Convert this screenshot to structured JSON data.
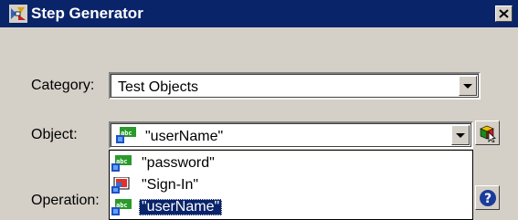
{
  "window": {
    "title": "Step Generator",
    "app_icon": "step-generator-icon",
    "close_icon": "close-icon"
  },
  "category": {
    "label": "Category:",
    "value": "Test Objects"
  },
  "object": {
    "label": "Object:",
    "value": "\"userName\"",
    "value_icon": "webedit-icon",
    "select_object_icon": "select-object-pointer-icon"
  },
  "object_dropdown": {
    "items": [
      {
        "label": "\"password\"",
        "icon": "webedit-icon",
        "selected": false
      },
      {
        "label": "\"Sign-In\"",
        "icon": "webimage-icon",
        "selected": false
      },
      {
        "label": "\"userName\"",
        "icon": "webedit-icon",
        "selected": true
      }
    ]
  },
  "operation": {
    "label": "Operation:",
    "help_icon": "help-icon"
  },
  "colors": {
    "titlebar": "#0a246a",
    "selection": "#0a246a",
    "dialog_bg": "#d4d0c8"
  }
}
